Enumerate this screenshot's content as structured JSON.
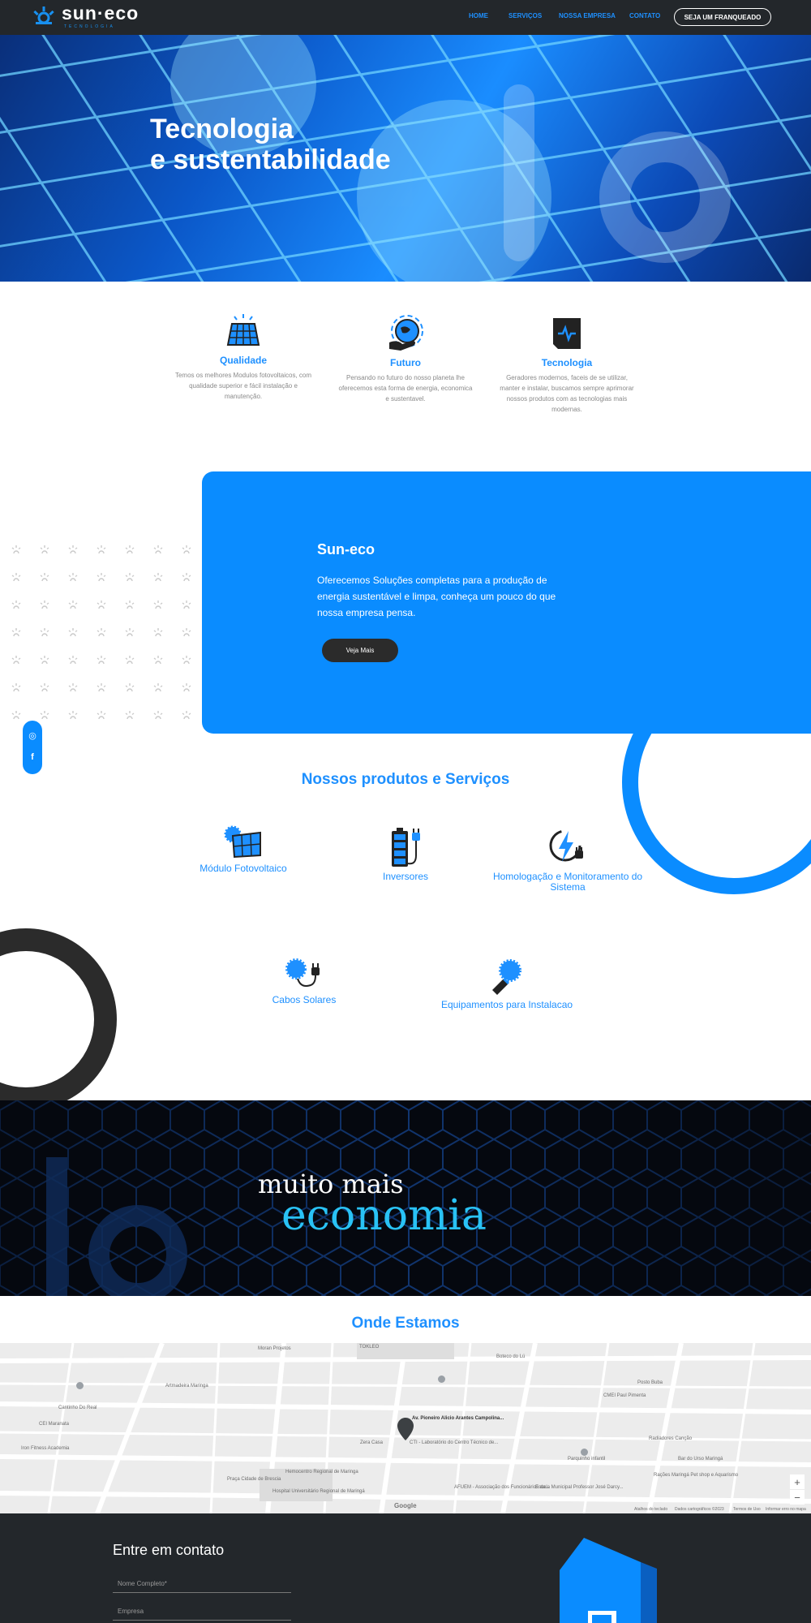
{
  "header": {
    "logo_name": "sun·eco",
    "logo_sub": "TECNOLOGIA",
    "nav": [
      {
        "label": "HOME"
      },
      {
        "label": "SERVIÇOS"
      },
      {
        "label": "NOSSA EMPRESA"
      },
      {
        "label": "CONTATO"
      }
    ],
    "cta": "SEJA UM FRANQUEADO"
  },
  "hero": {
    "title_line1": "Tecnologia",
    "title_line2": "e sustentabilidade"
  },
  "features": [
    {
      "title": "Qualidade",
      "desc": "Temos os melhores Modulos fotovoltaicos, com qualidade superior e fácil instalação e manutenção.",
      "icon": "solar-panel-icon"
    },
    {
      "title": "Futuro",
      "desc": "Pensando no futuro do nosso planeta  lhe oferecemos esta forma de energia, economica e sustentavel.",
      "icon": "planet-hand-icon"
    },
    {
      "title": "Tecnologia",
      "desc": "Geradores modernos, faceis de se utilizar, manter e instalar, buscamos sempre aprimorar nossos produtos com as tecnologias mais modernas.",
      "icon": "chip-icon"
    }
  ],
  "about": {
    "title": "Sun-eco",
    "text": "Oferecemos Soluções completas para a produção de energia sustentável e limpa, conheça um pouco do que nossa empresa pensa.",
    "button": "Veja Mais"
  },
  "social": [
    {
      "icon": "instagram-icon",
      "glyph": "◎"
    },
    {
      "icon": "facebook-icon",
      "glyph": "f"
    }
  ],
  "products": {
    "title": "Nossos produtos e Serviços",
    "items": [
      {
        "name": "Módulo Fotovoltaico",
        "icon": "pv-module-icon"
      },
      {
        "name": "Inversores",
        "icon": "inverter-battery-icon"
      },
      {
        "name": "Homologação e Monitoramento do Sistema",
        "icon": "lightning-plug-icon"
      },
      {
        "name": "Cabos Solares",
        "icon": "solar-cable-icon"
      },
      {
        "name": "Equipamentos para Instalacao",
        "icon": "equipment-icon"
      }
    ]
  },
  "banner": {
    "line1": "muito mais",
    "line2": "economia"
  },
  "location": {
    "title": "Onde Estamos",
    "map_labels": [
      "Av. Pioneiro Alicio Arantes Campolina...",
      "Hospital Universitário Regional de Maringá",
      "CTI - Laboratório do Centro Técnico de...",
      "Zera Casa",
      "Moran Projetos",
      "TOKLEO",
      "Boteco do Lú",
      "Posto Buba",
      "CMEI Paul Pimenta",
      "Cantinho Do Real",
      "CEI Maranata",
      "Iron Fitness Academia",
      "Artmadeira Maringa",
      "Hemocentro Regional de Maringa",
      "Praça Cidade de Brescia",
      "Escola Municipal Professor José Darcy...",
      "AFUEM - Associação dos Funcionários da...",
      "Parquinho infantil",
      "Bar do Urso Maringá",
      "Radiadores Canção",
      "Rações Maringá Pet shop e Aquarismo",
      "Google",
      "Dados cartográficos ©2023",
      "Termos de Uso",
      "Informar erro no mapa",
      "Atalhos do teclado"
    ],
    "zoom_in": "+",
    "zoom_out": "−"
  },
  "contact": {
    "title": "Entre em contato",
    "field_name": "Nome Completo*",
    "field_company": "Empresa"
  },
  "colors": {
    "accent": "#1e90ff",
    "card_blue": "#0a8cff",
    "dark": "#23272b",
    "banner_cyan": "#29c2f5"
  }
}
